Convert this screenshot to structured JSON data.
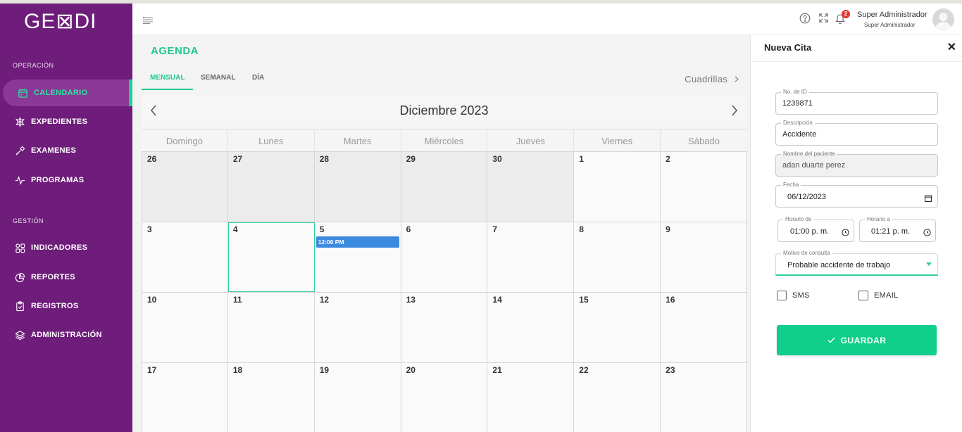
{
  "brand": {
    "logo_text": "GE⊠DI"
  },
  "sidebar": {
    "sections": [
      {
        "label": "OPERACIÓN"
      },
      {
        "label": "GESTIÓN"
      }
    ],
    "items": [
      {
        "label": "CALENDARIO",
        "icon": "calendar-icon",
        "active": true
      },
      {
        "label": "EXPEDIENTES",
        "icon": "medical-cross-icon"
      },
      {
        "label": "EXAMENES",
        "icon": "tool-icon"
      },
      {
        "label": "PROGRAMAS",
        "icon": "pulse-icon"
      },
      {
        "label": "INDICADORES",
        "icon": "grid-icon"
      },
      {
        "label": "REPORTES",
        "icon": "pie-chart-icon"
      },
      {
        "label": "REGISTROS",
        "icon": "clipboard-icon"
      },
      {
        "label": "ADMINISTRACIÓN",
        "icon": "layers-icon"
      }
    ]
  },
  "header": {
    "notification_count": "2",
    "user_name": "Super Administrador",
    "user_role": "Super Administrador"
  },
  "agenda": {
    "title": "AGENDA",
    "tabs": [
      {
        "label": "MENSUAL",
        "active": true
      },
      {
        "label": "SEMANAL"
      },
      {
        "label": "DÍA"
      }
    ],
    "cuadrillas_label": "Cuadrillas",
    "month_label": "Diciembre 2023",
    "weekdays": [
      "Domingo",
      "Lunes",
      "Martes",
      "Miércoles",
      "Jueves",
      "Viernes",
      "Sábado"
    ],
    "weeks": [
      [
        {
          "n": "26",
          "other": true
        },
        {
          "n": "27",
          "other": true
        },
        {
          "n": "28",
          "other": true
        },
        {
          "n": "29",
          "other": true
        },
        {
          "n": "30",
          "other": true
        },
        {
          "n": "1"
        },
        {
          "n": "2"
        }
      ],
      [
        {
          "n": "3"
        },
        {
          "n": "4",
          "today": true
        },
        {
          "n": "5",
          "event": "12:00 PM"
        },
        {
          "n": "6"
        },
        {
          "n": "7"
        },
        {
          "n": "8"
        },
        {
          "n": "9"
        }
      ],
      [
        {
          "n": "10"
        },
        {
          "n": "11"
        },
        {
          "n": "12"
        },
        {
          "n": "13"
        },
        {
          "n": "14"
        },
        {
          "n": "15"
        },
        {
          "n": "16"
        }
      ],
      [
        {
          "n": "17"
        },
        {
          "n": "18"
        },
        {
          "n": "19"
        },
        {
          "n": "20"
        },
        {
          "n": "21"
        },
        {
          "n": "22"
        },
        {
          "n": "23"
        }
      ]
    ]
  },
  "panel": {
    "title": "Nueva Cita",
    "id_label": "No. de ID",
    "id_value": "1239871",
    "desc_label": "Descripción",
    "desc_value": "Accidente",
    "patient_label": "Nombre del paciente",
    "patient_value": "adan duarte perez",
    "date_label": "Fecha",
    "date_value": "06/12/2023",
    "from_label": "Horario de",
    "from_value": "01:00 p. m.",
    "to_label": "Horario a",
    "to_value": "01:21 p. m.",
    "reason_label": "Motivo de consulta",
    "reason_value": "Probable accidente de trabajo",
    "sms_label": "SMS",
    "email_label": "EMAIL",
    "save_label": "GUARDAR"
  },
  "colors": {
    "sidebar": "#6e1d7a",
    "accent": "#1fc88a",
    "event": "#3c8ae0",
    "badge": "#e3342f"
  }
}
